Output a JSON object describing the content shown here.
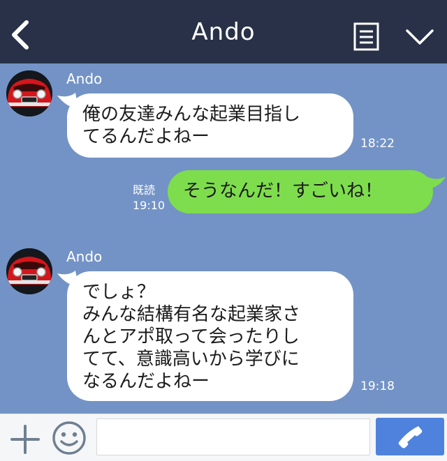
{
  "header": {
    "title": "Ando",
    "back_icon": "chevron-left-icon",
    "menu_icon": "notes-menu-icon",
    "dropdown_icon": "chevron-down-icon"
  },
  "messages": [
    {
      "direction": "incoming",
      "sender": "Ando",
      "text": "俺の友達みんな起業目指し\nてるんだよねー",
      "time": "18:22"
    },
    {
      "direction": "outgoing",
      "text": "そうなんだ！すごいね！",
      "read_label": "既読",
      "time": "19:10"
    },
    {
      "direction": "incoming",
      "sender": "Ando",
      "text": "でしょ？\nみんな結構有名な起業家さ\nんとアポ取って会ったりし\nてて、意識高いから学びに\nなるんだよねー",
      "time": "19:18"
    }
  ],
  "input_bar": {
    "message_value": "",
    "plus_icon": "plus-icon",
    "sticker_icon": "smile-icon",
    "call_icon": "phone-icon"
  },
  "colors": {
    "header_bg": "#283147",
    "chat_bg": "#7393c6",
    "incoming_bubble": "#ffffff",
    "outgoing_bubble": "#7edd4d",
    "call_button": "#4e82dd"
  }
}
